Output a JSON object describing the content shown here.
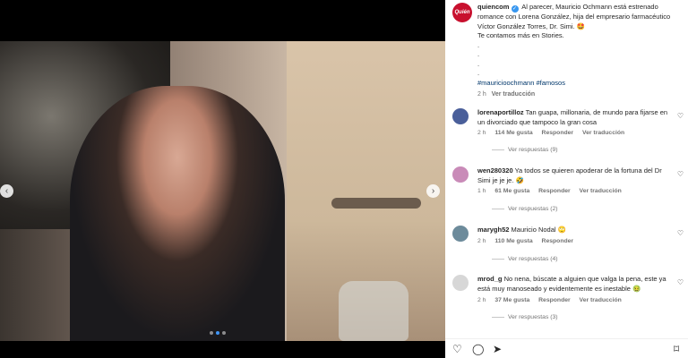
{
  "post": {
    "account": "quiencom",
    "logo_text": "Quién",
    "caption_body": "Al parecer, Mauricio Ochmann está estrenado romance con Lorena González, hija del empresario farmacéutico Víctor González Torres, Dr. Simi. 🤩",
    "caption_line2": "Te contamos más en Stories.",
    "dots": [
      ".",
      ".",
      ".",
      "."
    ],
    "hashtags": "#mauricioochmann #famosos",
    "time": "2 h",
    "translation_label": "Ver traducción"
  },
  "comments": [
    {
      "user": "lorenaportilloz",
      "text": "Tan guapa, millonaria, de mundo para fijarse en un divorciado que tampoco la gran cosa",
      "time": "2 h",
      "likes": "114 Me gusta",
      "reply": "Responder",
      "translate": "Ver traducción",
      "view_replies": "Ver respuestas (9)",
      "avatar_color": "#4a5f9a"
    },
    {
      "user": "wen280320",
      "text": "Ya todos se quieren apoderar de la fortuna del Dr Simi je je je. 🤣",
      "time": "1 h",
      "likes": "61 Me gusta",
      "reply": "Responder",
      "translate": "Ver traducción",
      "view_replies": "Ver respuestas (2)",
      "avatar_color": "#c98bb8"
    },
    {
      "user": "marygh52",
      "text": "Mauricio Nodal 🙄",
      "time": "2 h",
      "likes": "110 Me gusta",
      "reply": "Responder",
      "translate": "",
      "view_replies": "Ver respuestas (4)",
      "avatar_color": "#6d8b9b"
    },
    {
      "user": "mrod_g",
      "text": "No nena, búscate a alguien que valga la pena, este ya está muy manoseado y evidentemente es inestable 🤢",
      "time": "2 h",
      "likes": "37 Me gusta",
      "reply": "Responder",
      "translate": "Ver traducción",
      "view_replies": "Ver respuestas (3)",
      "avatar_color": "#d7d7d7"
    }
  ],
  "icons": {
    "like": "heart-icon",
    "comment": "comment-icon",
    "share": "share-icon",
    "save": "bookmark-icon",
    "nav_prev": "chevron-left-icon",
    "nav_next": "chevron-right-icon"
  },
  "colors": {
    "accent": "#3897f0",
    "brand": "#c8102e",
    "link": "#00376b"
  }
}
